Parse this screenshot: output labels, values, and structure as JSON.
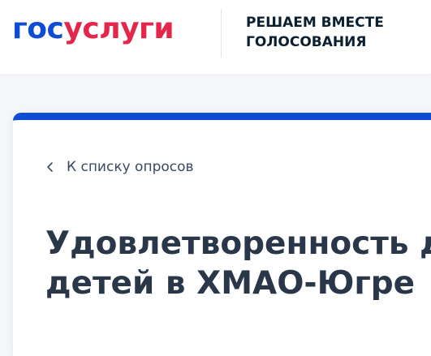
{
  "header": {
    "logo": {
      "part1": "гос",
      "part2": "услуги"
    },
    "tagline": {
      "line1": "РЕШАЕМ ВМЕСТЕ",
      "line2": "ГОЛОСОВАНИЯ"
    }
  },
  "main": {
    "back_link": {
      "icon": "chevron-left-icon",
      "label": "К списку опросов"
    },
    "title": {
      "line1": "Удовлетворенность д",
      "line2": "детей в ХМАО-Югре"
    }
  },
  "colors": {
    "brand_blue": "#0d4cd3",
    "brand_red": "#e4264b",
    "text_dark": "#0b1f33",
    "accent_bar": "#0d4cd3"
  }
}
